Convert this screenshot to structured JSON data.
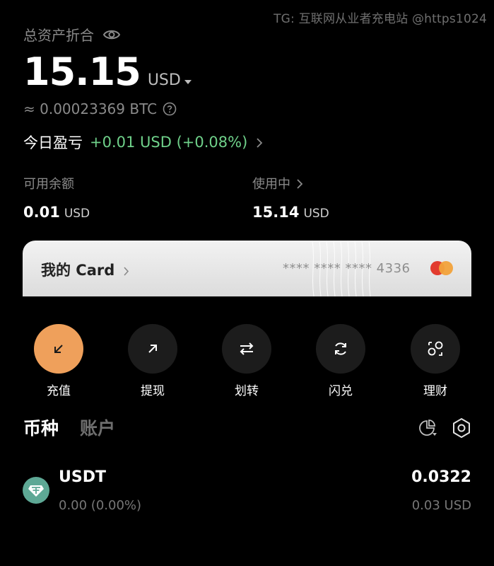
{
  "watermark": "TG: 互联网从业者充电站 @https1024",
  "assets": {
    "label": "总资产折合",
    "balance": "15.15",
    "currency": "USD",
    "btc_equiv": "≈ 0.00023369 BTC",
    "pnl_label": "今日盈亏",
    "pnl_value": "+0.01 USD (+0.08%)"
  },
  "stats": {
    "available": {
      "label": "可用余额",
      "value": "0.01",
      "unit": "USD"
    },
    "in_use": {
      "label": "使用中",
      "value": "15.14",
      "unit": "USD"
    }
  },
  "card": {
    "title": "我的 Card",
    "number": "**** **** **** 4336"
  },
  "actions": [
    {
      "label": "充值",
      "icon": "arrow-down-left-icon"
    },
    {
      "label": "提现",
      "icon": "arrow-up-right-icon"
    },
    {
      "label": "划转",
      "icon": "transfer-icon"
    },
    {
      "label": "闪兑",
      "icon": "refresh-icon"
    },
    {
      "label": "理财",
      "icon": "finance-icon"
    }
  ],
  "tabs": [
    {
      "label": "币种",
      "active": true
    },
    {
      "label": "账户",
      "active": false
    }
  ],
  "coins": [
    {
      "name": "USDT",
      "change": "0.00 (0.00%)",
      "amount": "0.0322",
      "value": "0.03 USD"
    }
  ],
  "colors": {
    "accent": "#efa05b",
    "positive": "#6fd18a",
    "tether": "#5ea895"
  }
}
